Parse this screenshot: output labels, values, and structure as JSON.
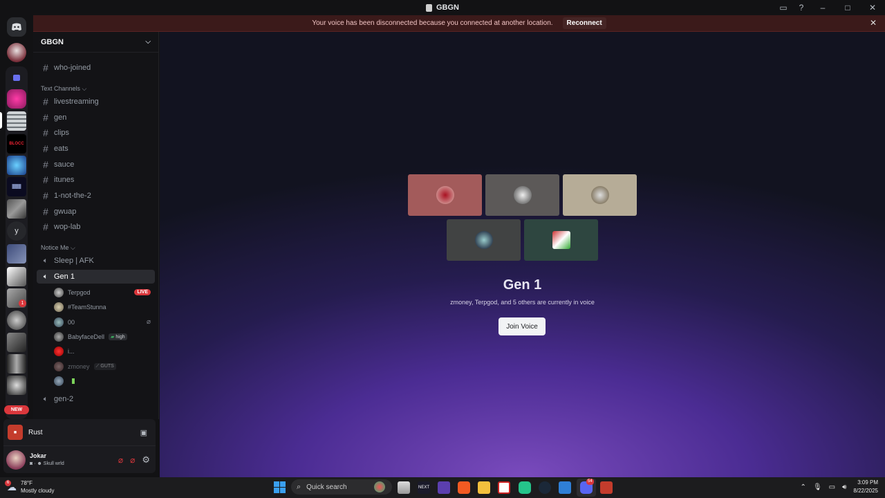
{
  "window": {
    "title": "GBGN"
  },
  "banner": {
    "message": "Your voice has been disconnected because you connected at another location.",
    "action": "Reconnect"
  },
  "guild_sidebar": {
    "text_server_label": "y",
    "new_badge": "NEW",
    "mention_count": "1"
  },
  "server": {
    "name": "GBGN"
  },
  "channels": {
    "top": [
      {
        "label": "who-joined"
      }
    ],
    "categories": [
      {
        "label": "Text Channels",
        "items": [
          "livestreaming",
          "gen",
          "clips",
          "eats",
          "sauce",
          "itunes",
          "1-not-the-2",
          "gwuap",
          "wop-lab"
        ]
      },
      {
        "label": "Notice Me",
        "items": [
          "Sleep | AFK",
          "Gen 1"
        ]
      }
    ],
    "voice_users": [
      {
        "name": "Terpgod",
        "badge": "LIVE"
      },
      {
        "name": "#TeamStunna"
      },
      {
        "name": "00"
      },
      {
        "name": "BabyfaceDell",
        "tag": "high"
      },
      {
        "name": "i..."
      },
      {
        "name": "zmoney",
        "tag": "GUTS"
      },
      {
        "name": ""
      }
    ],
    "after": "gen-2"
  },
  "activity": {
    "label": "Rust"
  },
  "user": {
    "name": "Jokar",
    "status": "Skull wrld"
  },
  "voice": {
    "title": "Gen 1",
    "subtitle": "zmoney, Terpgod, and 5 others are currently in voice",
    "join_label": "Join Voice"
  },
  "taskbar": {
    "temperature": "78°F",
    "condition": "Mostly cloudy",
    "weather_badge": "6",
    "search_placeholder": "Quick search",
    "discord_badge": "54",
    "time": "3:09 PM",
    "date": "8/22/2025"
  },
  "colors": {
    "accent": "#5865f2",
    "live": "#da373c",
    "banner_bg": "#3b1a1a"
  }
}
